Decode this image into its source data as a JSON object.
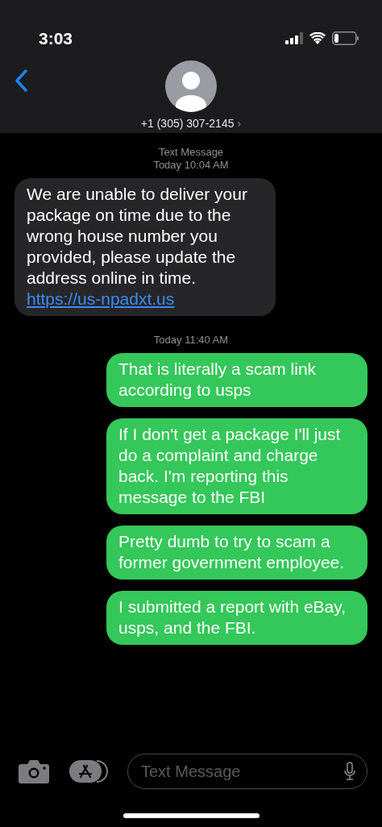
{
  "status_bar": {
    "time": "3:03"
  },
  "header": {
    "contact": "+1 (305) 307-2145",
    "chevron": "›"
  },
  "conversation": [
    {
      "kind": "timestamp",
      "label": "Text Message",
      "time": "Today 10:04 AM"
    },
    {
      "kind": "incoming",
      "text": "We are unable to deliver your package on time due to the wrong house number you provided, please update the address online in time.",
      "link": "https://us-npadxt.us"
    },
    {
      "kind": "timestamp",
      "time": "Today 11:40 AM"
    },
    {
      "kind": "outgoing",
      "text": "That is literally a scam link according to usps"
    },
    {
      "kind": "outgoing",
      "text": "If I don't get a package I'll just do a complaint and charge back. I'm reporting this message to the FBI"
    },
    {
      "kind": "outgoing",
      "text": "Pretty dumb to try to scam a former government employee."
    },
    {
      "kind": "outgoing",
      "text": "I submitted a report with eBay, usps, and the FBI."
    }
  ],
  "composer": {
    "placeholder": "Text Message"
  }
}
